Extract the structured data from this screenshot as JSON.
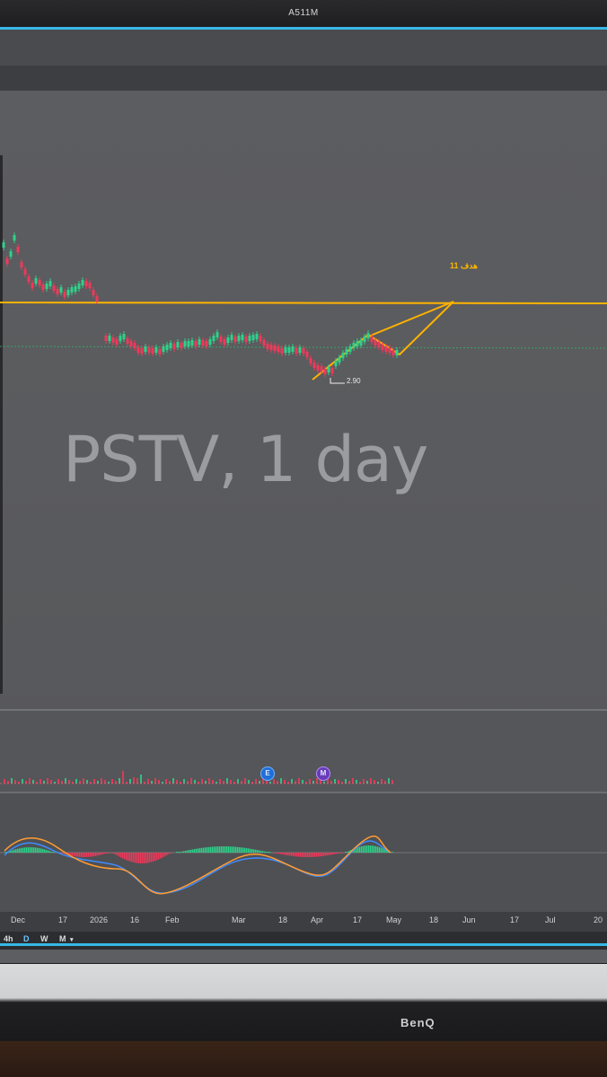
{
  "monitor": {
    "window_title": "A511M",
    "brand": "BenQ"
  },
  "chart": {
    "watermark": "PSTV, 1 day",
    "target_label": "هدف 11",
    "low_label": "2.90",
    "events": [
      {
        "name": "earnings",
        "letter": "E",
        "color": "#1f6fd8"
      },
      {
        "name": "meeting",
        "letter": "M",
        "color": "#6a3bb8"
      }
    ],
    "time_ticks": [
      "Dec",
      "17",
      "2026",
      "16",
      "Feb",
      "Mar",
      "18",
      "Apr",
      "17",
      "May",
      "18",
      "Jun",
      "17",
      "Jul",
      "20"
    ],
    "timeframes": [
      {
        "label": "4h",
        "active": false
      },
      {
        "label": "D",
        "active": true
      },
      {
        "label": "W",
        "active": false
      },
      {
        "label": "M",
        "active": false
      }
    ],
    "dropdown_icon": "chevron-down-icon",
    "colors": {
      "up_candle": "#2ed18a",
      "down_candle": "#f0385a",
      "resistance_line": "#ffb300",
      "support_line": "#33b56b",
      "macd_line": "#3e8cff",
      "signal_line": "#ff9c33",
      "accent_bezel": "#37b8e6"
    }
  }
}
